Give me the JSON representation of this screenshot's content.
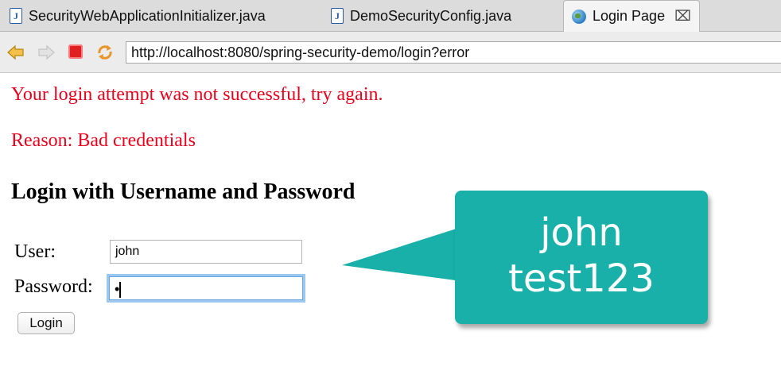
{
  "tabs": [
    {
      "label": "SecurityWebApplicationInitializer.java",
      "icon": "java-file-icon"
    },
    {
      "label": "DemoSecurityConfig.java",
      "icon": "java-file-icon"
    },
    {
      "label": "Login Page",
      "icon": "globe-icon",
      "active": true
    }
  ],
  "navbar": {
    "url": "http://localhost:8080/spring-security-demo/login?error"
  },
  "page": {
    "error_message": "Your login attempt was not successful, try again.",
    "reason": "Reason: Bad credentials",
    "heading": "Login with Username and Password",
    "user_label": "User:",
    "user_value": "john",
    "password_label": "Password:",
    "password_value": "•",
    "login_button": "Login"
  },
  "callout": {
    "line1": "john",
    "line2": "test123",
    "color": "#18b0a8"
  },
  "colors": {
    "error": "#e8001c",
    "focus_ring": "#9cc8f0"
  }
}
